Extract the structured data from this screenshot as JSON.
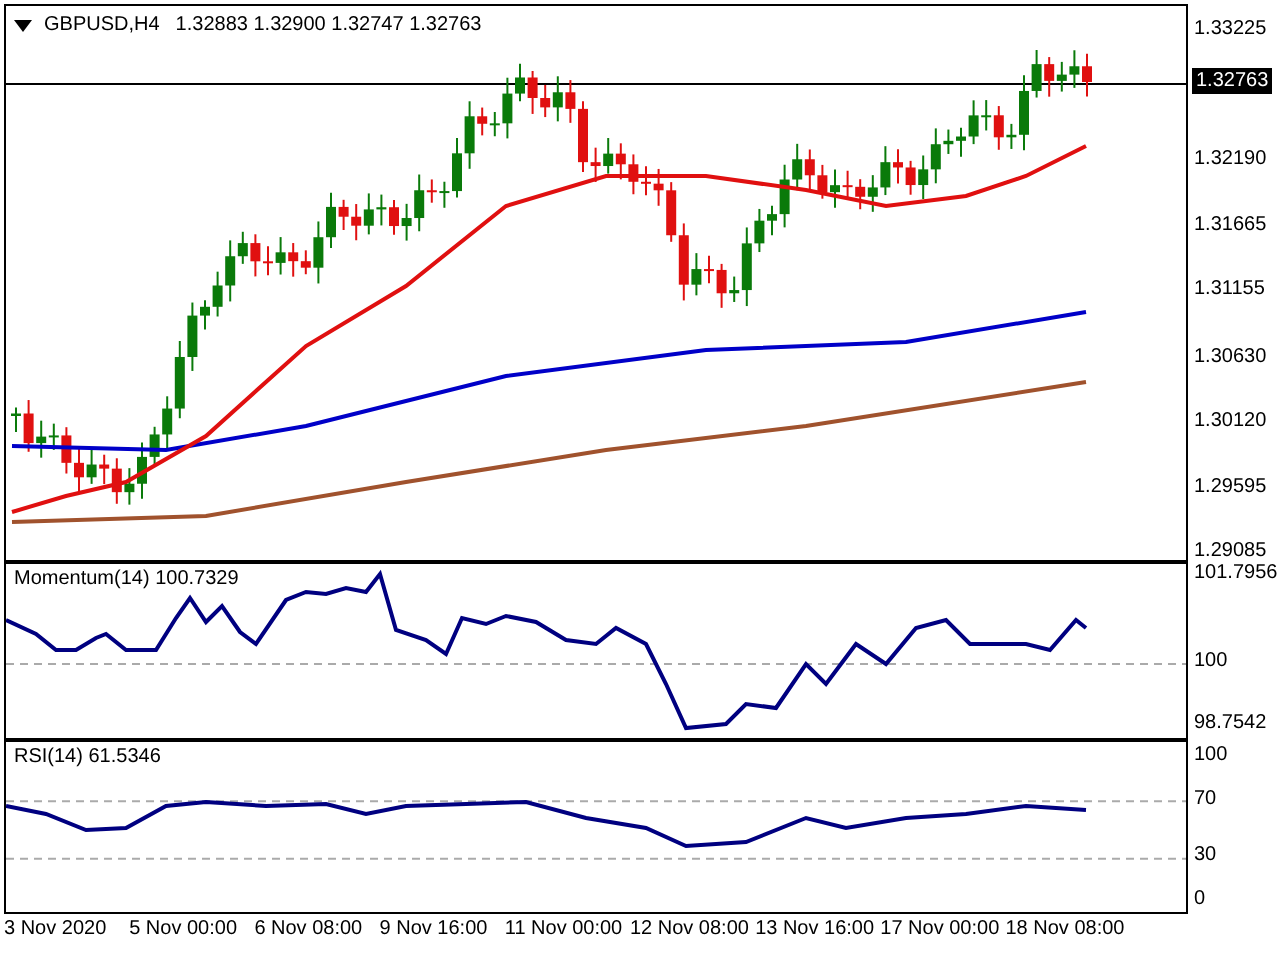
{
  "header": {
    "symbol": "GBPUSD,H4",
    "quote": "1.32883 1.32900 1.32747 1.32763"
  },
  "price_axis": {
    "labels": [
      "1.33225",
      "1.32190",
      "1.31665",
      "1.31155",
      "1.30630",
      "1.30120",
      "1.29595",
      "1.29085"
    ],
    "current_price": "1.32763"
  },
  "momentum": {
    "label": "Momentum(14) 100.7329",
    "axis_labels": [
      "101.7956",
      "100",
      "98.7542"
    ]
  },
  "rsi": {
    "label": "RSI(14) 61.5346",
    "axis_labels": [
      "100",
      "70",
      "30",
      "0"
    ]
  },
  "time_axis": {
    "labels": [
      "3 Nov 2020",
      "5 Nov 00:00",
      "6 Nov 08:00",
      "9 Nov 16:00",
      "11 Nov 00:00",
      "12 Nov 08:00",
      "13 Nov 16:00",
      "17 Nov 00:00",
      "18 Nov 08:00"
    ]
  }
}
